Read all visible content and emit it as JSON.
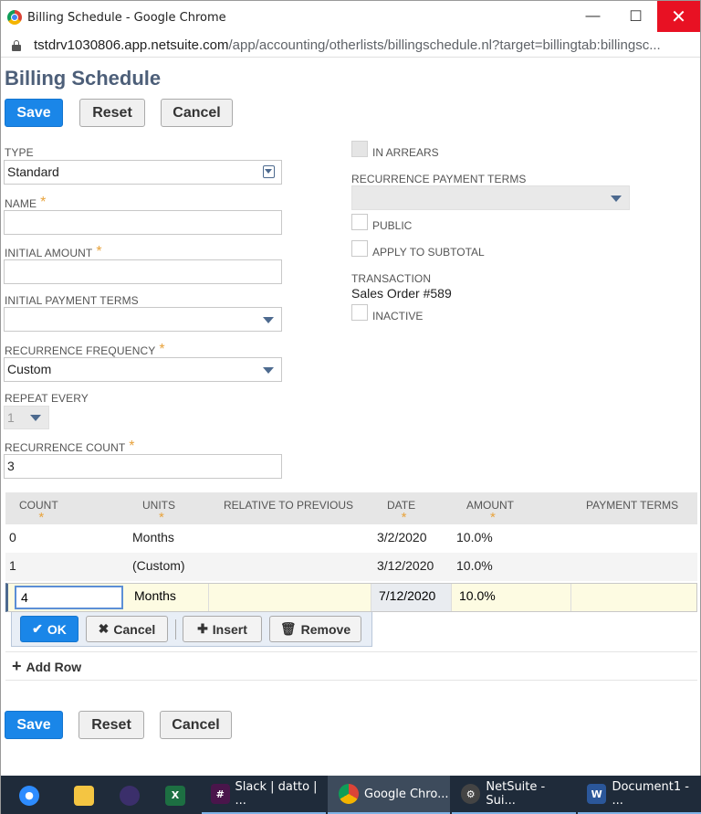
{
  "window": {
    "title": "Billing Schedule - Google Chrome",
    "minimize": "—",
    "maximize": "☐",
    "close": "✕"
  },
  "address": {
    "domain": "tstdrv1030806.app.netsuite.com",
    "path": "/app/accounting/otherlists/billingschedule.nl?target=billingtab:billingsc..."
  },
  "page": {
    "title": "Billing Schedule",
    "top_buttons": {
      "save": "Save",
      "reset": "Reset",
      "cancel": "Cancel"
    },
    "bottom_buttons": {
      "save": "Save",
      "reset": "Reset",
      "cancel": "Cancel"
    }
  },
  "form": {
    "type": {
      "label": "TYPE",
      "value": "Standard"
    },
    "name": {
      "label": "NAME",
      "value": ""
    },
    "initial_amount": {
      "label": "INITIAL AMOUNT",
      "value": ""
    },
    "initial_payment_terms": {
      "label": "INITIAL PAYMENT TERMS",
      "value": ""
    },
    "recurrence_frequency": {
      "label": "RECURRENCE FREQUENCY",
      "value": "Custom"
    },
    "repeat_every": {
      "label": "REPEAT EVERY",
      "value": "1"
    },
    "recurrence_count": {
      "label": "RECURRENCE COUNT",
      "value": "3"
    },
    "in_arrears": {
      "label": "IN ARREARS"
    },
    "recurrence_payment_terms": {
      "label": "RECURRENCE PAYMENT TERMS",
      "value": ""
    },
    "public": {
      "label": "PUBLIC"
    },
    "apply_to_subtotal": {
      "label": "APPLY TO SUBTOTAL"
    },
    "transaction": {
      "label": "TRANSACTION",
      "value": "Sales Order #589"
    },
    "inactive": {
      "label": "INACTIVE"
    },
    "required_mark": "*"
  },
  "table": {
    "headers": {
      "count": "COUNT",
      "units": "UNITS",
      "relative": "RELATIVE TO PREVIOUS",
      "date": "DATE",
      "amount": "AMOUNT",
      "payment_terms": "PAYMENT TERMS"
    },
    "rows": [
      {
        "count": "0",
        "units": "Months",
        "date": "3/2/2020",
        "amount": "10.0%"
      },
      {
        "count": "1",
        "units": "(Custom)",
        "date": "3/12/2020",
        "amount": "10.0%"
      }
    ],
    "edit_row": {
      "count": "4",
      "units": "Months",
      "date": "7/12/2020",
      "amount": "10.0%"
    },
    "row_actions": {
      "ok": "OK",
      "cancel": "Cancel",
      "insert": "Insert",
      "remove": "Remove"
    },
    "add_row": "Add Row"
  },
  "taskbar": {
    "items": [
      {
        "label": "",
        "icon": "zoom-icon",
        "color": "#2d8cff"
      },
      {
        "label": "",
        "icon": "file-explorer-icon",
        "color": "#f4c542"
      },
      {
        "label": "",
        "icon": "eclipse-icon",
        "color": "#3b2f6b"
      },
      {
        "label": "",
        "icon": "excel-icon",
        "color": "#1d6f42"
      },
      {
        "label": "Slack | datto | ...",
        "icon": "slack-icon",
        "color": "#4a154b"
      },
      {
        "label": "Google Chro...",
        "icon": "chrome-icon",
        "color": "#4285f4"
      },
      {
        "label": "NetSuite - Sui...",
        "icon": "netsuite-icon",
        "color": "#333"
      },
      {
        "label": "Document1 - ...",
        "icon": "word-icon",
        "color": "#2b579a"
      }
    ]
  }
}
